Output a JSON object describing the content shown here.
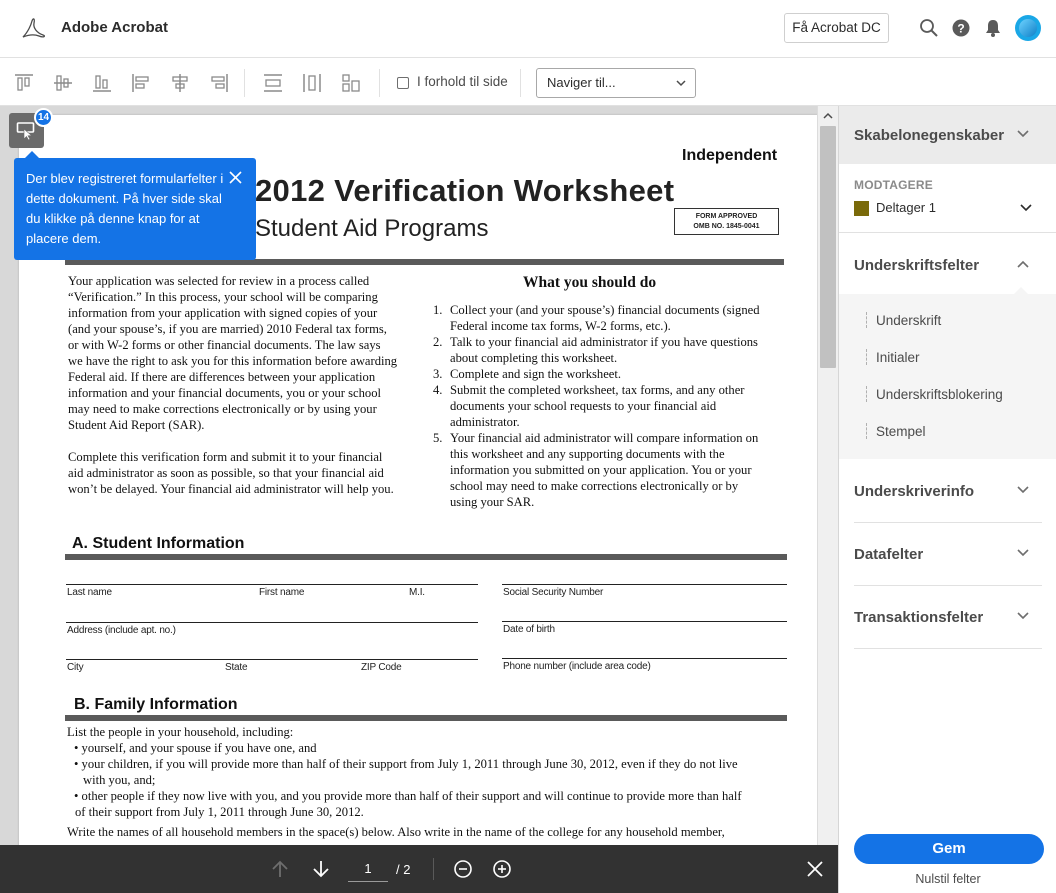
{
  "header": {
    "app_title": "Adobe Acrobat",
    "get_button": "Få Acrobat DC"
  },
  "toolbar": {
    "proportional_label": "I forhold til side",
    "navigate_placeholder": "Naviger til..."
  },
  "document": {
    "header_right": "Independent",
    "title": "2012 Verification Worksheet",
    "subtitle": "Student Aid Programs",
    "form_approved_1": "FORM APPROVED",
    "form_approved_2": "OMB NO. 1845-0041",
    "intro_lines": [
      "Your application was selected for review in a process called",
      "“Verification.”  In this process, your school will be comparing",
      "information from your application with signed copies of your",
      "(and your spouse’s, if you are married) 2010 Federal tax forms,",
      "or with W-2 forms or other financial documents.  The law says",
      "we have the right to ask you for this information before awarding",
      "Federal aid.  If there are differences between your application",
      "information and your financial documents, you or your school",
      "may need to make corrections electronically or by using your",
      "Student Aid Report (SAR)."
    ],
    "complete_lines": [
      "Complete this verification form and submit it to your financial",
      "aid administrator as soon as possible, so that your financial aid",
      "won’t be delayed.  Your financial aid administrator will help you."
    ],
    "what_heading": "What you should do",
    "steps": [
      {
        "num": "1.",
        "lines": [
          "Collect your (and your spouse’s) financial documents (signed",
          "Federal income tax forms, W-2 forms, etc.)."
        ]
      },
      {
        "num": "2.",
        "lines": [
          "Talk to your financial aid administrator if you have questions",
          "about completing this worksheet."
        ]
      },
      {
        "num": "3.",
        "lines": [
          "Complete and sign the worksheet."
        ]
      },
      {
        "num": "4.",
        "lines": [
          "Submit the completed worksheet, tax forms, and any other",
          "documents your school requests to your financial aid",
          "administrator."
        ]
      },
      {
        "num": "5.",
        "lines": [
          "Your financial aid administrator will compare information on",
          "this worksheet and any supporting documents with the",
          "information you submitted on your application.  You or your",
          "school may need to make corrections electronically or by",
          "using your SAR."
        ]
      }
    ],
    "section_a": "A.  Student Information",
    "field_labels": {
      "last_name": "Last name",
      "first_name": "First name",
      "mi": "M.I.",
      "ssn": "Social Security Number",
      "address": "Address (include apt. no.)",
      "dob": "Date of birth",
      "city": "City",
      "state": "State",
      "zip": "ZIP Code",
      "phone": "Phone number (include area code)"
    },
    "section_b": "B.  Family Information",
    "family_lines": [
      "List the people in your household, including:",
      "• yourself, and your spouse if you have one, and",
      "• your children, if you will provide more than half of their support from July 1, 2011 through June 30, 2012, even if they do not live",
      "with you, and;",
      "• other people if they now live with you, and you provide more than half of their support and will continue to provide more than half",
      "of their support from July 1, 2011 through June 30, 2012.",
      "Write the names of all household members in the space(s) below.  Also write in the name of the college for any household member,"
    ]
  },
  "tooltip": {
    "badge": "14",
    "text": "Der blev registreret formularfelter i dette dokument. På hver side skal du klikke på denne knap for at placere dem."
  },
  "pager": {
    "current": "1",
    "total": "/ 2"
  },
  "panel": {
    "template_props": "Skabelonegenskaber",
    "recipients_label": "MODTAGERE",
    "participant": "Deltager 1",
    "participant_color": "#7a6a0a",
    "signature_fields": "Underskriftsfelter",
    "signature_items": [
      "Underskrift",
      "Initialer",
      "Underskriftsblokering",
      "Stempel"
    ],
    "signer_info": "Underskriverinfo",
    "data_fields": "Datafelter",
    "transaction_fields": "Transaktionsfelter",
    "save": "Gem",
    "reset": "Nulstil felter"
  },
  "colors": {
    "accent": "#1473e6",
    "bottom_bar": "#323232"
  }
}
